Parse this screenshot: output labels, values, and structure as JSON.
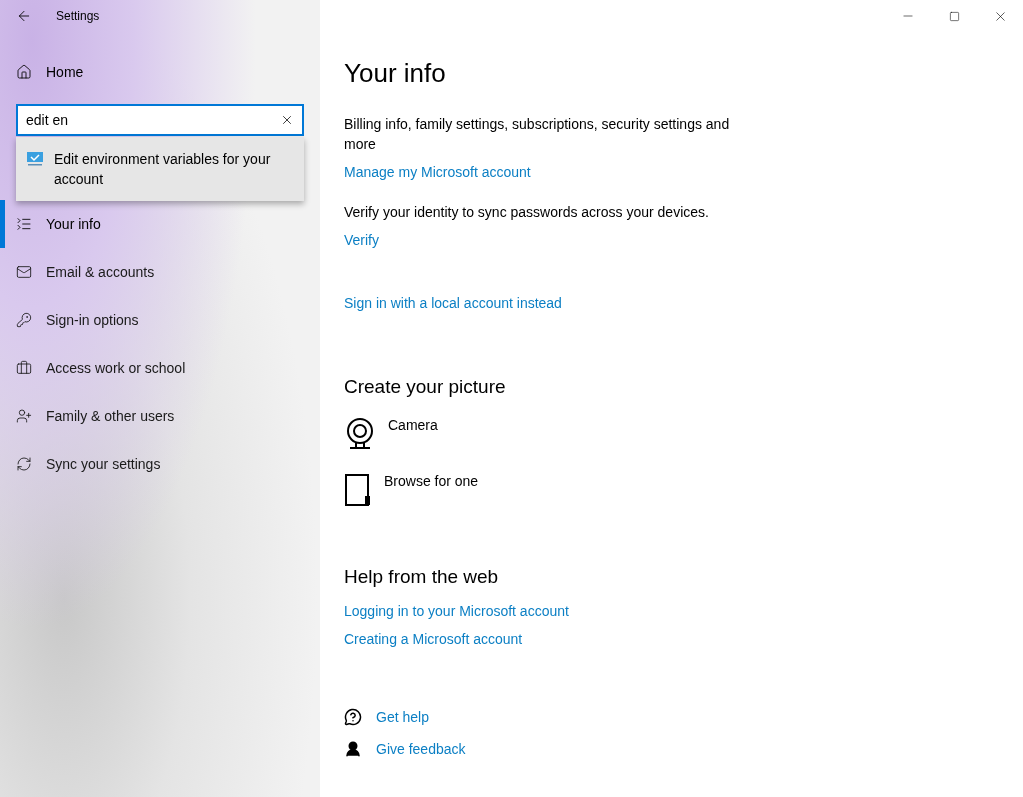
{
  "window": {
    "title": "Settings"
  },
  "sidebar": {
    "home": "Home",
    "search": {
      "value": "edit en"
    },
    "suggestions": [
      {
        "text": "Edit environment variables for your account"
      }
    ],
    "items": [
      {
        "label": "Your info",
        "selected": true
      },
      {
        "label": "Email & accounts",
        "selected": false
      },
      {
        "label": "Sign-in options",
        "selected": false
      },
      {
        "label": "Access work or school",
        "selected": false
      },
      {
        "label": "Family & other users",
        "selected": false
      },
      {
        "label": "Sync your settings",
        "selected": false
      }
    ]
  },
  "main": {
    "title": "Your info",
    "billing_text": "Billing info, family settings, subscriptions, security settings and more",
    "manage_link": "Manage my Microsoft account",
    "verify_text": "Verify your identity to sync passwords across your devices.",
    "verify_link": "Verify",
    "local_link": "Sign in with a local account instead",
    "picture_heading": "Create your picture",
    "picture_options": [
      {
        "kind": "camera",
        "label": "Camera"
      },
      {
        "kind": "browse",
        "label": "Browse for one"
      }
    ],
    "help_heading": "Help from the web",
    "help_links": [
      "Logging in to your Microsoft account",
      "Creating a Microsoft account"
    ],
    "footer_links": [
      {
        "kind": "help",
        "label": "Get help"
      },
      {
        "kind": "feedback",
        "label": "Give feedback"
      }
    ]
  }
}
